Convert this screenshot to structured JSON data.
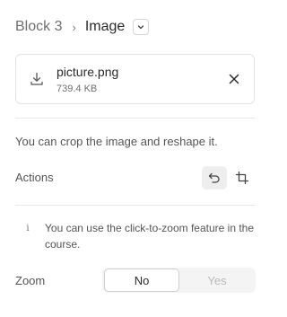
{
  "breadcrumb": {
    "parent": "Block 3",
    "current": "Image"
  },
  "file": {
    "name": "picture.png",
    "size": "739.4 KB"
  },
  "crop_hint": "You can crop the image and reshape it.",
  "actions": {
    "label": "Actions",
    "undo_icon": "undo-icon",
    "crop_icon": "crop-icon"
  },
  "info": {
    "icon": "i",
    "text": "You can use the click-to-zoom feature in the course."
  },
  "zoom": {
    "label": "Zoom",
    "options": [
      "No",
      "Yes"
    ],
    "selected": "No"
  }
}
